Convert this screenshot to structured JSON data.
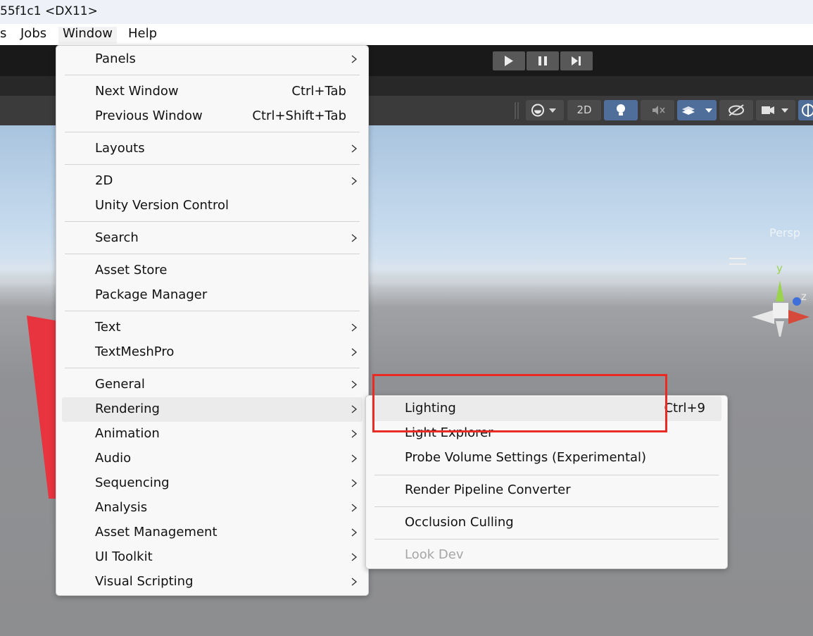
{
  "window": {
    "title": "55f1c1 <DX11>"
  },
  "menubar": {
    "items": [
      {
        "label": "s"
      },
      {
        "label": "Jobs"
      },
      {
        "label": "Window",
        "active": true
      },
      {
        "label": "Help"
      }
    ]
  },
  "scene": {
    "persp_label": "Persp",
    "mode_2d_label": "2D"
  },
  "gizmo": {
    "x_label": "x",
    "y_label": "y",
    "z_label": "z"
  },
  "colors": {
    "accent": "#4f6f9a",
    "highlight_box": "#ea2a24",
    "menu_bg": "#f8f8f8"
  },
  "window_menu": {
    "items": [
      {
        "label": "Panels",
        "submenu": true
      },
      {
        "label": "Next Window",
        "shortcut": "Ctrl+Tab"
      },
      {
        "label": "Previous Window",
        "shortcut": "Ctrl+Shift+Tab"
      },
      {
        "label": "Layouts",
        "submenu": true
      },
      {
        "label": "2D",
        "submenu": true
      },
      {
        "label": "Unity Version Control"
      },
      {
        "label": "Search",
        "submenu": true
      },
      {
        "label": "Asset Store"
      },
      {
        "label": "Package Manager"
      },
      {
        "label": "Text",
        "submenu": true
      },
      {
        "label": "TextMeshPro",
        "submenu": true
      },
      {
        "label": "General",
        "submenu": true
      },
      {
        "label": "Rendering",
        "submenu": true,
        "hover": true
      },
      {
        "label": "Animation",
        "submenu": true
      },
      {
        "label": "Audio",
        "submenu": true
      },
      {
        "label": "Sequencing",
        "submenu": true
      },
      {
        "label": "Analysis",
        "submenu": true
      },
      {
        "label": "Asset Management",
        "submenu": true
      },
      {
        "label": "UI Toolkit",
        "submenu": true
      },
      {
        "label": "Visual Scripting",
        "submenu": true
      }
    ]
  },
  "rendering_submenu": {
    "items": [
      {
        "label": "Lighting",
        "shortcut": "Ctrl+9",
        "hover": true
      },
      {
        "label": "Light Explorer"
      },
      {
        "label": "Probe Volume Settings (Experimental)"
      },
      {
        "label": "Render Pipeline Converter"
      },
      {
        "label": "Occlusion Culling"
      },
      {
        "label": "Look Dev",
        "disabled": true
      }
    ]
  }
}
